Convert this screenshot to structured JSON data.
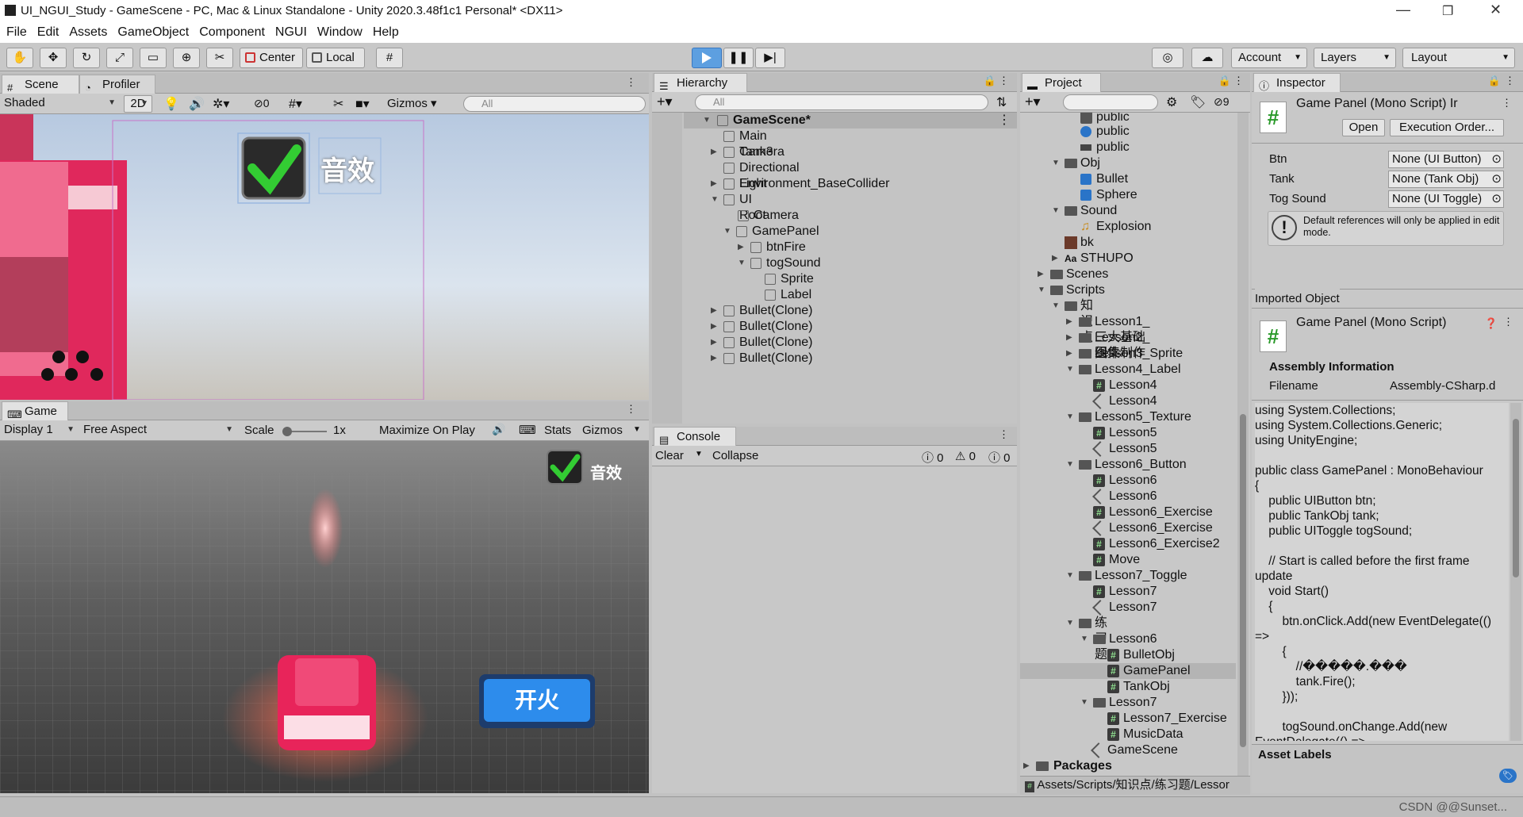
{
  "titlebar": {
    "title": "UI_NGUI_Study - GameScene - PC, Mac & Linux Standalone - Unity 2020.3.48f1c1 Personal* <DX11>"
  },
  "menu": [
    "File",
    "Edit",
    "Assets",
    "GameObject",
    "Component",
    "NGUI",
    "Window",
    "Help"
  ],
  "toolbar": {
    "center": "Center",
    "local": "Local",
    "account": "Account",
    "layers": "Layers",
    "layout": "Layout"
  },
  "scene": {
    "tab": "Scene",
    "profiler_tab": "Profiler",
    "shaded": "Shaded",
    "twod": "2D",
    "hidden_count": "0",
    "gizmos": "Gizmos",
    "search_placeholder": "All",
    "ui_text": "音效"
  },
  "game": {
    "tab": "Game",
    "display": "Display 1",
    "aspect": "Free Aspect",
    "scale_label": "Scale",
    "scale_value": "1x",
    "maximize": "Maximize On Play",
    "stats": "Stats",
    "gizmos": "Gizmos",
    "sound_label": "音效",
    "fire_label": "开火"
  },
  "hierarchy": {
    "tab": "Hierarchy",
    "search_placeholder": "All",
    "items": [
      "GameScene*",
      "Main Camera",
      "Tank3",
      "Directional Light",
      "Environment_BaseCollider",
      "UI Root",
      "Camera",
      "GamePanel",
      "btnFire",
      "togSound",
      "Sprite",
      "Label",
      "Bullet(Clone)",
      "Bullet(Clone)",
      "Bullet(Clone)",
      "Bullet(Clone)"
    ]
  },
  "console": {
    "tab": "Console",
    "clear": "Clear",
    "collapse": "Collapse",
    "errors": "0",
    "warnings": "0",
    "logs": "0"
  },
  "project": {
    "tab": "Project",
    "hidden_count": "9",
    "items": [
      "public",
      "public",
      "public",
      "Obj",
      "Bullet",
      "Sphere",
      "Sound",
      "Explosion",
      "bk",
      "STHUPO",
      "Scenes",
      "Scripts",
      "知识点",
      "Lesson1_三大基础组件",
      "Lesson2_图集制作",
      "Lesson3_Sprite",
      "Lesson4_Label",
      "Lesson4",
      "Lesson4",
      "Lesson5_Texture",
      "Lesson5",
      "Lesson5",
      "Lesson6_Button",
      "Lesson6",
      "Lesson6",
      "Lesson6_Exercise",
      "Lesson6_Exercise",
      "Lesson6_Exercise2",
      "Move",
      "Lesson7_Toggle",
      "Lesson7",
      "Lesson7",
      "练习题",
      "Lesson6",
      "BulletObj",
      "GamePanel",
      "TankObj",
      "Lesson7",
      "Lesson7_Exercise",
      "MusicData",
      "GameScene",
      "Packages"
    ],
    "path": "Assets/Scripts/知识点/练习题/Lessor"
  },
  "inspector": {
    "tab": "Inspector",
    "title": "Game Panel (Mono Script) Ir",
    "open": "Open",
    "exec_order": "Execution Order...",
    "fields": [
      {
        "label": "Btn",
        "value": "None (UI Button)"
      },
      {
        "label": "Tank",
        "value": "None (Tank Obj)"
      },
      {
        "label": "Tog Sound",
        "value": "None (UI Toggle)"
      }
    ],
    "note": "Default references will only be applied in edit mode.",
    "imported": "Imported Object",
    "imported_title": "Game Panel (Mono Script)",
    "assembly_info": "Assembly Information",
    "filename_label": "Filename",
    "filename_value": "Assembly-CSharp.d",
    "code": "using System.Collections;\nusing System.Collections.Generic;\nusing UnityEngine;\n\npublic class GamePanel : MonoBehaviour\n{\n    public UIButton btn;\n    public TankObj tank;\n    public UIToggle togSound;\n\n    // Start is called before the first frame\nupdate\n    void Start()\n    {\n        btn.onClick.Add(new EventDelegate(()\n=>\n        {\n            //�����.���\n            tank.Fire();\n        }));\n\n        togSound.onChange.Add(new\nEventDelegate(() =>\n        {",
    "asset_labels": "Asset Labels"
  },
  "watermark": "CSDN @@Sunset..."
}
